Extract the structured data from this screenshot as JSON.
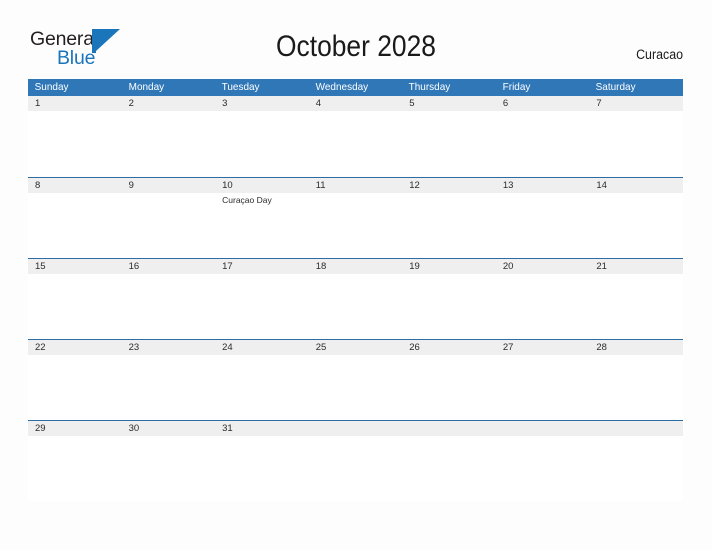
{
  "brand": {
    "name_top": "General",
    "name_bottom": "Blue",
    "mark_icon": "triangle-logo-icon",
    "color_dark": "#231f20",
    "color_blue": "#1b75bb"
  },
  "header": {
    "title": "October 2028",
    "locale": "Curacao"
  },
  "theme": {
    "header_blue": "#3077b8",
    "row_border_blue": "#2e6da4",
    "date_band_gray": "#efefef",
    "page_background": "#fdfdfd",
    "text_dark": "#2b2b2b"
  },
  "calendar": {
    "month": "October",
    "year": "2028",
    "weekdays": [
      "Sunday",
      "Monday",
      "Tuesday",
      "Wednesday",
      "Thursday",
      "Friday",
      "Saturday"
    ],
    "weeks": [
      [
        {
          "day": "1",
          "events": []
        },
        {
          "day": "2",
          "events": []
        },
        {
          "day": "3",
          "events": []
        },
        {
          "day": "4",
          "events": []
        },
        {
          "day": "5",
          "events": []
        },
        {
          "day": "6",
          "events": []
        },
        {
          "day": "7",
          "events": []
        }
      ],
      [
        {
          "day": "8",
          "events": []
        },
        {
          "day": "9",
          "events": []
        },
        {
          "day": "10",
          "events": [
            "Curaçao Day"
          ]
        },
        {
          "day": "11",
          "events": []
        },
        {
          "day": "12",
          "events": []
        },
        {
          "day": "13",
          "events": []
        },
        {
          "day": "14",
          "events": []
        }
      ],
      [
        {
          "day": "15",
          "events": []
        },
        {
          "day": "16",
          "events": []
        },
        {
          "day": "17",
          "events": []
        },
        {
          "day": "18",
          "events": []
        },
        {
          "day": "19",
          "events": []
        },
        {
          "day": "20",
          "events": []
        },
        {
          "day": "21",
          "events": []
        }
      ],
      [
        {
          "day": "22",
          "events": []
        },
        {
          "day": "23",
          "events": []
        },
        {
          "day": "24",
          "events": []
        },
        {
          "day": "25",
          "events": []
        },
        {
          "day": "26",
          "events": []
        },
        {
          "day": "27",
          "events": []
        },
        {
          "day": "28",
          "events": []
        }
      ],
      [
        {
          "day": "29",
          "events": []
        },
        {
          "day": "30",
          "events": []
        },
        {
          "day": "31",
          "events": []
        },
        {
          "day": "",
          "events": []
        },
        {
          "day": "",
          "events": []
        },
        {
          "day": "",
          "events": []
        },
        {
          "day": "",
          "events": []
        }
      ]
    ]
  }
}
